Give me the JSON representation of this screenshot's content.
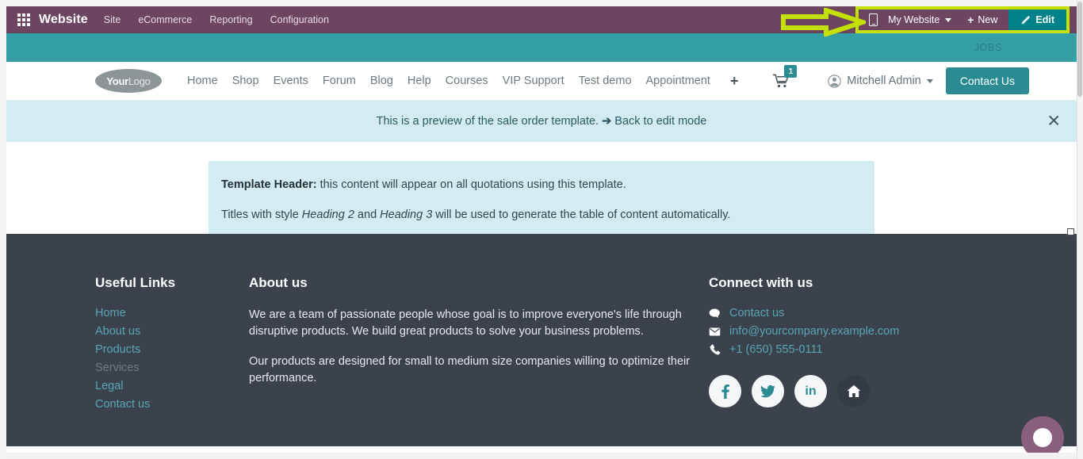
{
  "backend": {
    "apps_icon": "apps-grid-icon",
    "brand": "Website",
    "menu": [
      "Site",
      "eCommerce",
      "Reporting",
      "Configuration"
    ],
    "mobile_preview_icon": "mobile-phone-icon",
    "website_selector": "My Website",
    "new_label": "New",
    "new_icon": "plus-icon",
    "edit_label": "Edit",
    "edit_icon": "pencil-icon",
    "highlight_color": "#c4e000",
    "topbar_color": "#6d4560",
    "edit_button_color": "#00828a"
  },
  "annotation": {
    "type": "arrow-right",
    "color": "#c4e000"
  },
  "site": {
    "strip_text": "JOBS",
    "strip_color": "#34a0a6",
    "logo": {
      "prefix": "Your",
      "suffix": "Logo"
    },
    "nav_links": [
      "Home",
      "Shop",
      "Events",
      "Forum",
      "Blog",
      "Help",
      "Courses",
      "VIP Support",
      "Test demo",
      "Appointment"
    ],
    "nav_plus": "+",
    "cart_icon": "shopping-cart-icon",
    "cart_count": "1",
    "user_icon": "user-circle-icon",
    "user_name": "Mitchell Admin",
    "cta_label": "Contact Us",
    "cta_color": "#2a8b93"
  },
  "banner": {
    "message": "This is a preview of the sale order template.",
    "link_arrow": "➔",
    "link_label": "Back to edit mode",
    "close_icon": "close-icon",
    "background": "#d3ecf1"
  },
  "template_box": {
    "label": "Template Header:",
    "line1": "this content will appear on all quotations using this template.",
    "line2_before": "Titles with style ",
    "line2_h2": "Heading 2",
    "line2_mid": " and ",
    "line2_h3": "Heading 3",
    "line2_after": " will be used to generate the table of content automatically.",
    "background": "#d3ecf1"
  },
  "footer": {
    "background": "#3b424c",
    "useful_links": {
      "heading": "Useful Links",
      "items": [
        {
          "label": "Home",
          "muted": false
        },
        {
          "label": "About us",
          "muted": false
        },
        {
          "label": "Products",
          "muted": false
        },
        {
          "label": "Services",
          "muted": true
        },
        {
          "label": "Legal",
          "muted": false
        },
        {
          "label": "Contact us",
          "muted": false
        }
      ]
    },
    "about": {
      "heading": "About us",
      "para1": "We are a team of passionate people whose goal is to improve everyone's life through disruptive products. We build great products to solve your business problems.",
      "para2": "Our products are designed for small to medium size companies willing to optimize their performance."
    },
    "connect": {
      "heading": "Connect with us",
      "rows": [
        {
          "icon": "comment-icon",
          "glyph": "●",
          "label": "Contact us"
        },
        {
          "icon": "envelope-icon",
          "glyph": "✉",
          "label": "info@yourcompany.example.com"
        },
        {
          "icon": "phone-icon",
          "glyph": "☎",
          "label": "+1 (650) 555-0111"
        }
      ],
      "socials": [
        {
          "name": "facebook-icon",
          "glyph": "f",
          "dark": false
        },
        {
          "name": "twitter-icon",
          "glyph": "t",
          "dark": false
        },
        {
          "name": "linkedin-icon",
          "glyph": "in",
          "dark": false
        },
        {
          "name": "home-icon",
          "glyph": "h",
          "dark": true
        }
      ]
    }
  },
  "chat": {
    "icon": "chat-bubble-icon",
    "color": "#8a5f7d"
  }
}
